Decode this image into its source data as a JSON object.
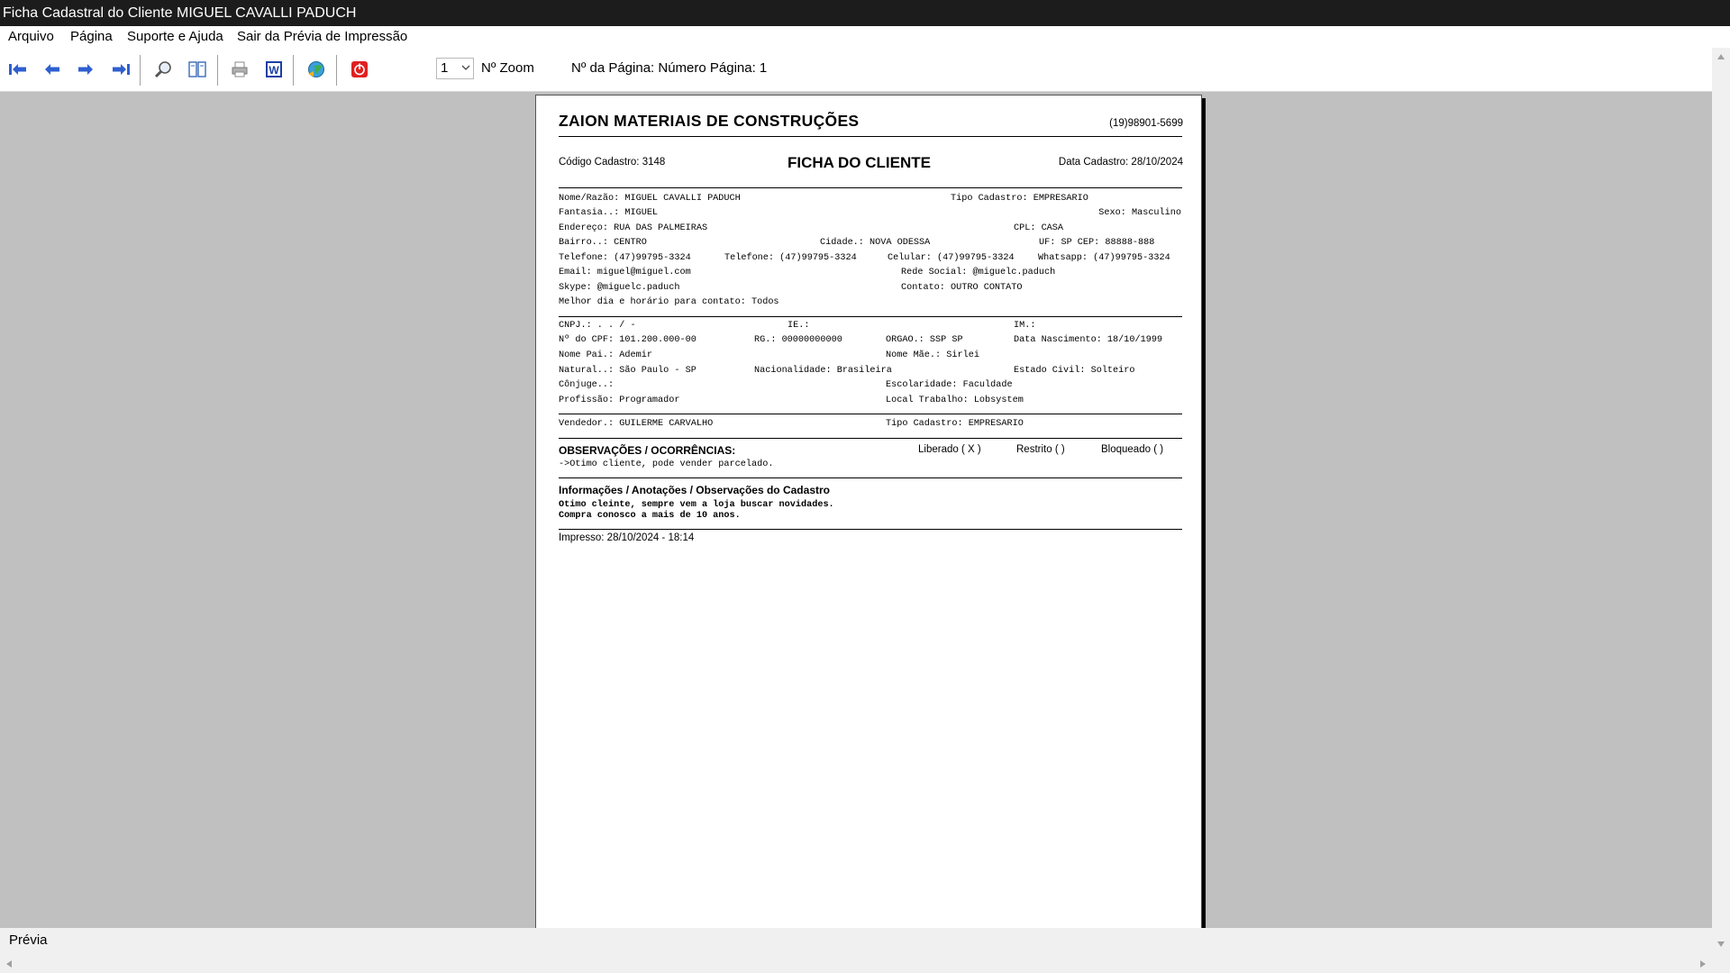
{
  "window": {
    "title": "Ficha Cadastral do Cliente MIGUEL CAVALLI PADUCH"
  },
  "menu": {
    "arquivo": "Arquivo",
    "pagina": "Página",
    "suporte": "Suporte e Ajuda",
    "sair": "Sair da Prévia de Impressão"
  },
  "toolbar": {
    "zoom_value": "1",
    "zoom_label": "Nº Zoom",
    "page_label": "Nº da Página: Número Página: 1",
    "icons": [
      "first-page-icon",
      "prev-page-icon",
      "next-page-icon",
      "last-page-icon",
      "zoom-icon",
      "two-pages-icon",
      "print-icon",
      "word-export-icon",
      "web-export-icon",
      "exit-icon"
    ]
  },
  "colors": {
    "titlebar": "#1c1c1c",
    "workspace": "#c0c0c0",
    "nav_arrows": "#2f5fd0",
    "exit": "#e02020"
  },
  "status": {
    "text": "Prévia"
  },
  "report": {
    "company": "ZAION MATERIAIS DE CONSTRUÇÕES",
    "phone": "(19)98901-5699",
    "codigo": "Código Cadastro:   3148",
    "title": "FICHA DO CLIENTE",
    "data_cadastro": "Data Cadastro: 28/10/2024",
    "nome": "Nome/Razão: MIGUEL CAVALLI PADUCH",
    "tipo_cadastro": "Tipo Cadastro: EMPRESARIO",
    "fantasia": "Fantasia..: MIGUEL",
    "sexo": "Sexo: Masculino",
    "endereco": "Endereço: RUA DAS PALMEIRAS",
    "cpl": "CPL: CASA",
    "bairro": "Bairro..: CENTRO",
    "cidade": "Cidade.: NOVA ODESSA",
    "uf_cep": "UF: SP  CEP: 88888-888",
    "telefone1": "Telefone: (47)99795-3324",
    "telefone2": "Telefone: (47)99795-3324",
    "celular": "Celular: (47)99795-3324",
    "whatsapp": "Whatsapp: (47)99795-3324",
    "email": "Email: miguel@miguel.com",
    "rede_social": "Rede Social: @miguelc.paduch",
    "skype": "Skype: @miguelc.paduch",
    "contato": "Contato: OUTRO CONTATO",
    "melhor_dia": "Melhor dia e horário para contato: Todos",
    "cnpj": "CNPJ.:   .   .   /    -",
    "ie": "IE.:",
    "im": "IM.:",
    "cpf": "Nº do CPF: 101.200.000-00",
    "rg": "RG.: 00000000000",
    "orgao": "ORGAO.: SSP SP",
    "nascimento": "Data Nascimento: 18/10/1999",
    "pai": "Nome Pai.: Ademir",
    "mae": "Nome Mãe.: Sirlei",
    "natural": "Natural..: São Paulo - SP",
    "nacionalidade": "Nacionalidade: Brasileira",
    "estado_civil": "Estado Civil: Solteiro",
    "conjuge": "Cônjuge..:",
    "escolaridade": "Escolaridade: Faculdade",
    "profissao": "Profissão: Programador",
    "local_trabalho": "Local Trabalho: Lobsystem",
    "vendedor": "Vendedor.: GUILERME CARVALHO",
    "tipo_cadastro2": "Tipo Cadastro: EMPRESARIO",
    "obs_title": "OBSERVAÇÕES / OCORRÊNCIAS:",
    "liberado": "Liberado ( X )",
    "restrito": "Restrito (  )",
    "bloqueado": "Bloqueado (  )",
    "obs_text": "->Otimo cliente, pode vender parcelado.",
    "info_title": "Informações / Anotações / Observações do Cadastro",
    "info_line1": "Otimo cleinte, sempre vem a loja buscar novidades.",
    "info_line2": "Compra conosco a mais de 10 anos.",
    "impresso": "Impresso: 28/10/2024 - 18:14"
  }
}
